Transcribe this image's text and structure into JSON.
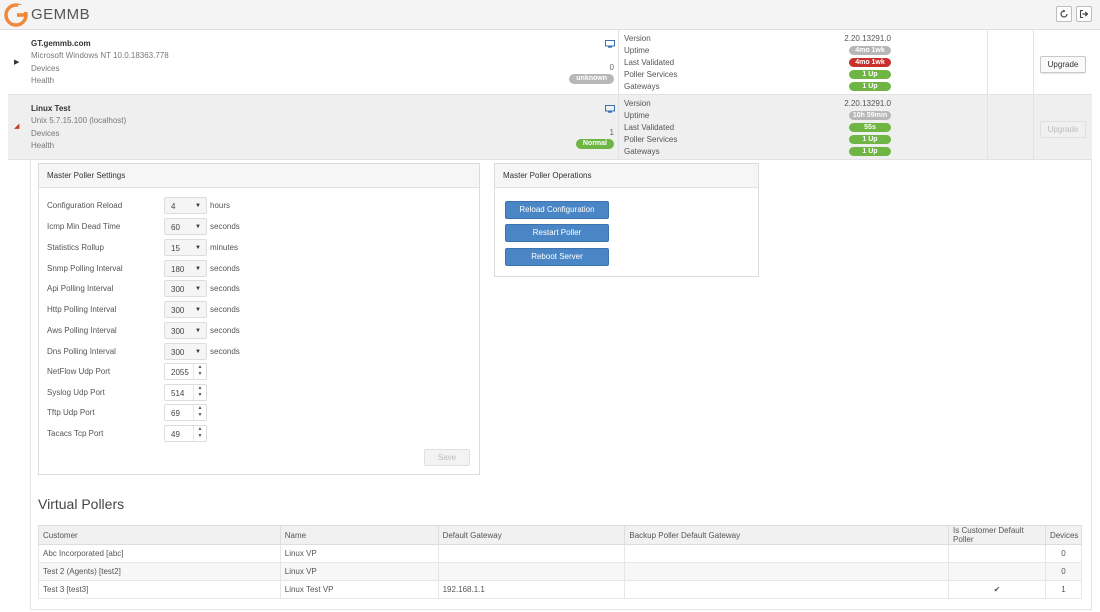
{
  "header": {
    "brand": "GEMMB",
    "brand_color": "#f0883c",
    "refresh_icon": "refresh-icon",
    "logout_icon": "logout-icon"
  },
  "pollers": [
    {
      "name": "GT.gemmb.com",
      "os": "Microsoft Windows NT 10.0.18363.778",
      "devices_label": "Devices",
      "devices": "0",
      "health_label": "Health",
      "health": "unknown",
      "version_label": "Version",
      "version": "2.20.13291.0",
      "uptime_label": "Uptime",
      "uptime": "4mo 1wk",
      "last_validated_label": "Last Validated",
      "last_validated": "4mo 1wk",
      "poller_services_label": "Poller Services",
      "poller_services": "1 Up",
      "gateways_label": "Gateways",
      "gateways": "1 Up",
      "upgrade_label": "Upgrade"
    },
    {
      "name": "Linux Test",
      "os": "Unix 5.7.15.100 (localhost)",
      "devices_label": "Devices",
      "devices": "1",
      "health_label": "Health",
      "health": "Normal",
      "version_label": "Version",
      "version": "2.20.13291.0",
      "uptime_label": "Uptime",
      "uptime": "10h 59min",
      "last_validated_label": "Last Validated",
      "last_validated": "55s",
      "poller_services_label": "Poller Services",
      "poller_services": "1 Up",
      "gateways_label": "Gateways",
      "gateways": "1 Up",
      "upgrade_label": "Upgrade"
    }
  ],
  "settings": {
    "title": "Master Poller Settings",
    "rows": [
      {
        "label": "Configuration Reload",
        "value": "4",
        "unit": "hours"
      },
      {
        "label": "Icmp Min Dead Time",
        "value": "60",
        "unit": "seconds"
      },
      {
        "label": "Statistics Rollup",
        "value": "15",
        "unit": "minutes"
      },
      {
        "label": "Snmp Polling Interval",
        "value": "180",
        "unit": "seconds"
      },
      {
        "label": "Api Polling Interval",
        "value": "300",
        "unit": "seconds"
      },
      {
        "label": "Http Polling Interval",
        "value": "300",
        "unit": "seconds"
      },
      {
        "label": "Aws Polling Interval",
        "value": "300",
        "unit": "seconds"
      },
      {
        "label": "Dns Polling Interval",
        "value": "300",
        "unit": "seconds"
      }
    ],
    "ports": [
      {
        "label": "NetFlow Udp Port",
        "value": "2055"
      },
      {
        "label": "Syslog Udp Port",
        "value": "514"
      },
      {
        "label": "Tftp Udp Port",
        "value": "69"
      },
      {
        "label": "Tacacs Tcp Port",
        "value": "49"
      }
    ],
    "save_label": "Save"
  },
  "operations": {
    "title": "Master Poller Operations",
    "reload_label": "Reload Configuration",
    "restart_label": "Restart Poller",
    "reboot_label": "Reboot Server"
  },
  "virtual_pollers": {
    "title": "Virtual Pollers",
    "columns": [
      "Customer",
      "Name",
      "Default Gateway",
      "Backup Poller Default Gateway",
      "Is Customer Default Poller",
      "Devices"
    ],
    "rows": [
      {
        "customer": "Abc Incorporated [abc]",
        "name": "Linux VP",
        "gateway": "",
        "backup": "",
        "is_default": "",
        "devices": "0"
      },
      {
        "customer": "Test 2 (Agents) [test2]",
        "name": "Linux VP",
        "gateway": "",
        "backup": "",
        "is_default": "",
        "devices": "0"
      },
      {
        "customer": "Test 3 [test3]",
        "name": "Linux Test VP",
        "gateway": "192.168.1.1",
        "backup": "",
        "is_default": "✔",
        "devices": "1"
      }
    ]
  }
}
